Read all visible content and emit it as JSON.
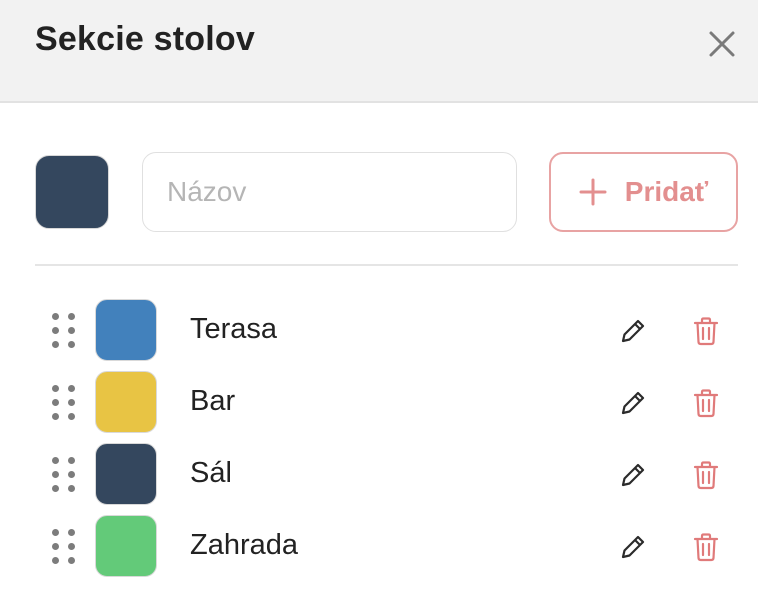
{
  "dialog": {
    "title": "Sekcie stolov",
    "close_icon": "close-icon"
  },
  "add_form": {
    "selected_color": "#34475e",
    "name_placeholder": "Názov",
    "name_value": "",
    "add_label": "Pridať",
    "add_icon": "plus-icon",
    "accent_color": "#e38f8f"
  },
  "sections": [
    {
      "name": "Terasa",
      "color": "#4281bc"
    },
    {
      "name": "Bar",
      "color": "#e8c444"
    },
    {
      "name": "Sál",
      "color": "#34475e"
    },
    {
      "name": "Zahrada",
      "color": "#63ca79"
    }
  ],
  "row_icons": {
    "drag": "drag-handle-icon",
    "edit": "pencil-icon",
    "delete": "trash-icon",
    "delete_color": "#e07a7a"
  }
}
